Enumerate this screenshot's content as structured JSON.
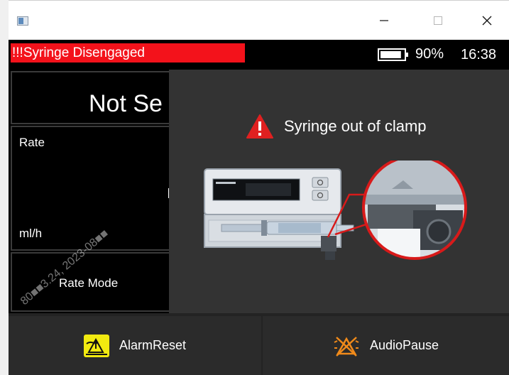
{
  "window": {
    "controls": {
      "minimize_icon": "minimize-icon",
      "maximize_icon": "maximize-icon",
      "close_icon": "close-icon"
    }
  },
  "status": {
    "alarm_text": "!!!Syringe Disengaged",
    "alarm_color": "#f3121b",
    "battery_percent": "90%",
    "battery_level": 0.9,
    "time": "16:38"
  },
  "main": {
    "infusion_status": "Not Se",
    "rate_label": "Rate",
    "rate_unit": "ml/h",
    "rate_mode_label": "Rate Mode"
  },
  "overlay": {
    "title": "Syringe out of clamp",
    "icon": "warning-triangle-icon"
  },
  "bottom": {
    "alarm_reset_label": "AlarmReset",
    "audio_pause_label": "AudioPause",
    "alarm_reset_icon": "alarm-reset-icon",
    "audio_pause_icon": "audio-pause-icon"
  },
  "watermark": "80■■3.24, 2023-08■■"
}
